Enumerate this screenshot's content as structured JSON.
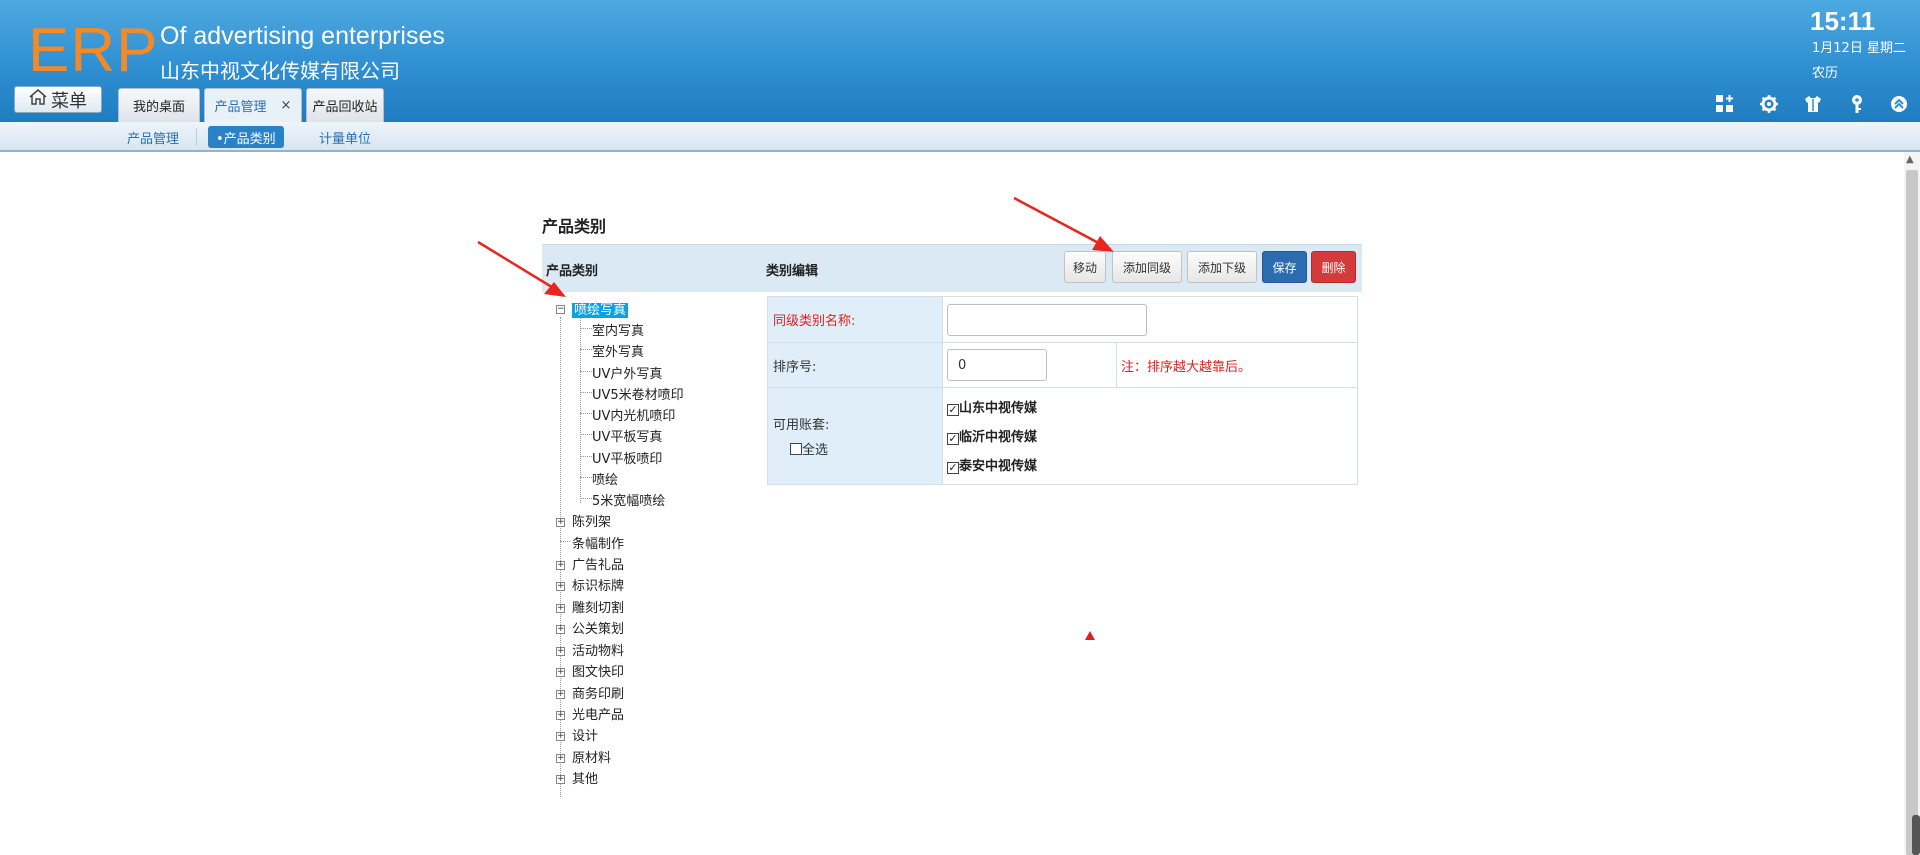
{
  "header": {
    "logo": "ERP",
    "app_name_en": "Of advertising enterprises",
    "app_name_cn": "山东中视文化传媒有限公司",
    "menu_label": "菜单",
    "clock": "15:11",
    "date": "1月12日 星期二",
    "lunar": "农历",
    "tabs": [
      {
        "label": "我的桌面"
      },
      {
        "label": "产品管理",
        "close": "×"
      },
      {
        "label": "产品回收站"
      }
    ],
    "icons": [
      "grid-add-icon",
      "gear-icon",
      "shirt-icon",
      "key-icon",
      "chevron-up-circle-icon"
    ],
    "brand_color": "#2f8fd1",
    "logo_color": "#f08a2a"
  },
  "subnav": {
    "items": [
      {
        "label": "产品管理"
      },
      {
        "label": "•产品类别"
      },
      {
        "label": "计量单位"
      }
    ]
  },
  "main": {
    "title": "产品类别",
    "bar_left": "产品类别",
    "bar_mid": "类别编辑",
    "buttons": {
      "move": "移动",
      "add_sibling": "添加同级",
      "add_child": "添加下级",
      "save": "保存",
      "delete": "删除"
    },
    "tree": {
      "selected": "喷绘写真",
      "children": [
        "室内写真",
        "室外写真",
        "UV户外写真",
        "UV5米卷材喷印",
        "UV内光机喷印",
        "UV平板写真",
        "UV平板喷印",
        "喷绘",
        "5米宽幅喷绘"
      ],
      "top_nodes": [
        "陈列架",
        "条幅制作",
        "广告礼品",
        "标识标牌",
        "雕刻切割",
        "公关策划",
        "活动物料",
        "图文快印",
        "商务印刷",
        "光电产品",
        "设计",
        "原材料",
        "其他"
      ]
    },
    "form": {
      "name_label": "同级类别名称:",
      "name_value": "",
      "order_label": "排序号:",
      "order_value": "0",
      "order_note": "注：排序越大越靠后。",
      "accounts_label": "可用账套:",
      "select_all": "全选",
      "accounts": [
        "山东中视传媒",
        "临沂中视传媒",
        "泰安中视传媒"
      ]
    }
  }
}
